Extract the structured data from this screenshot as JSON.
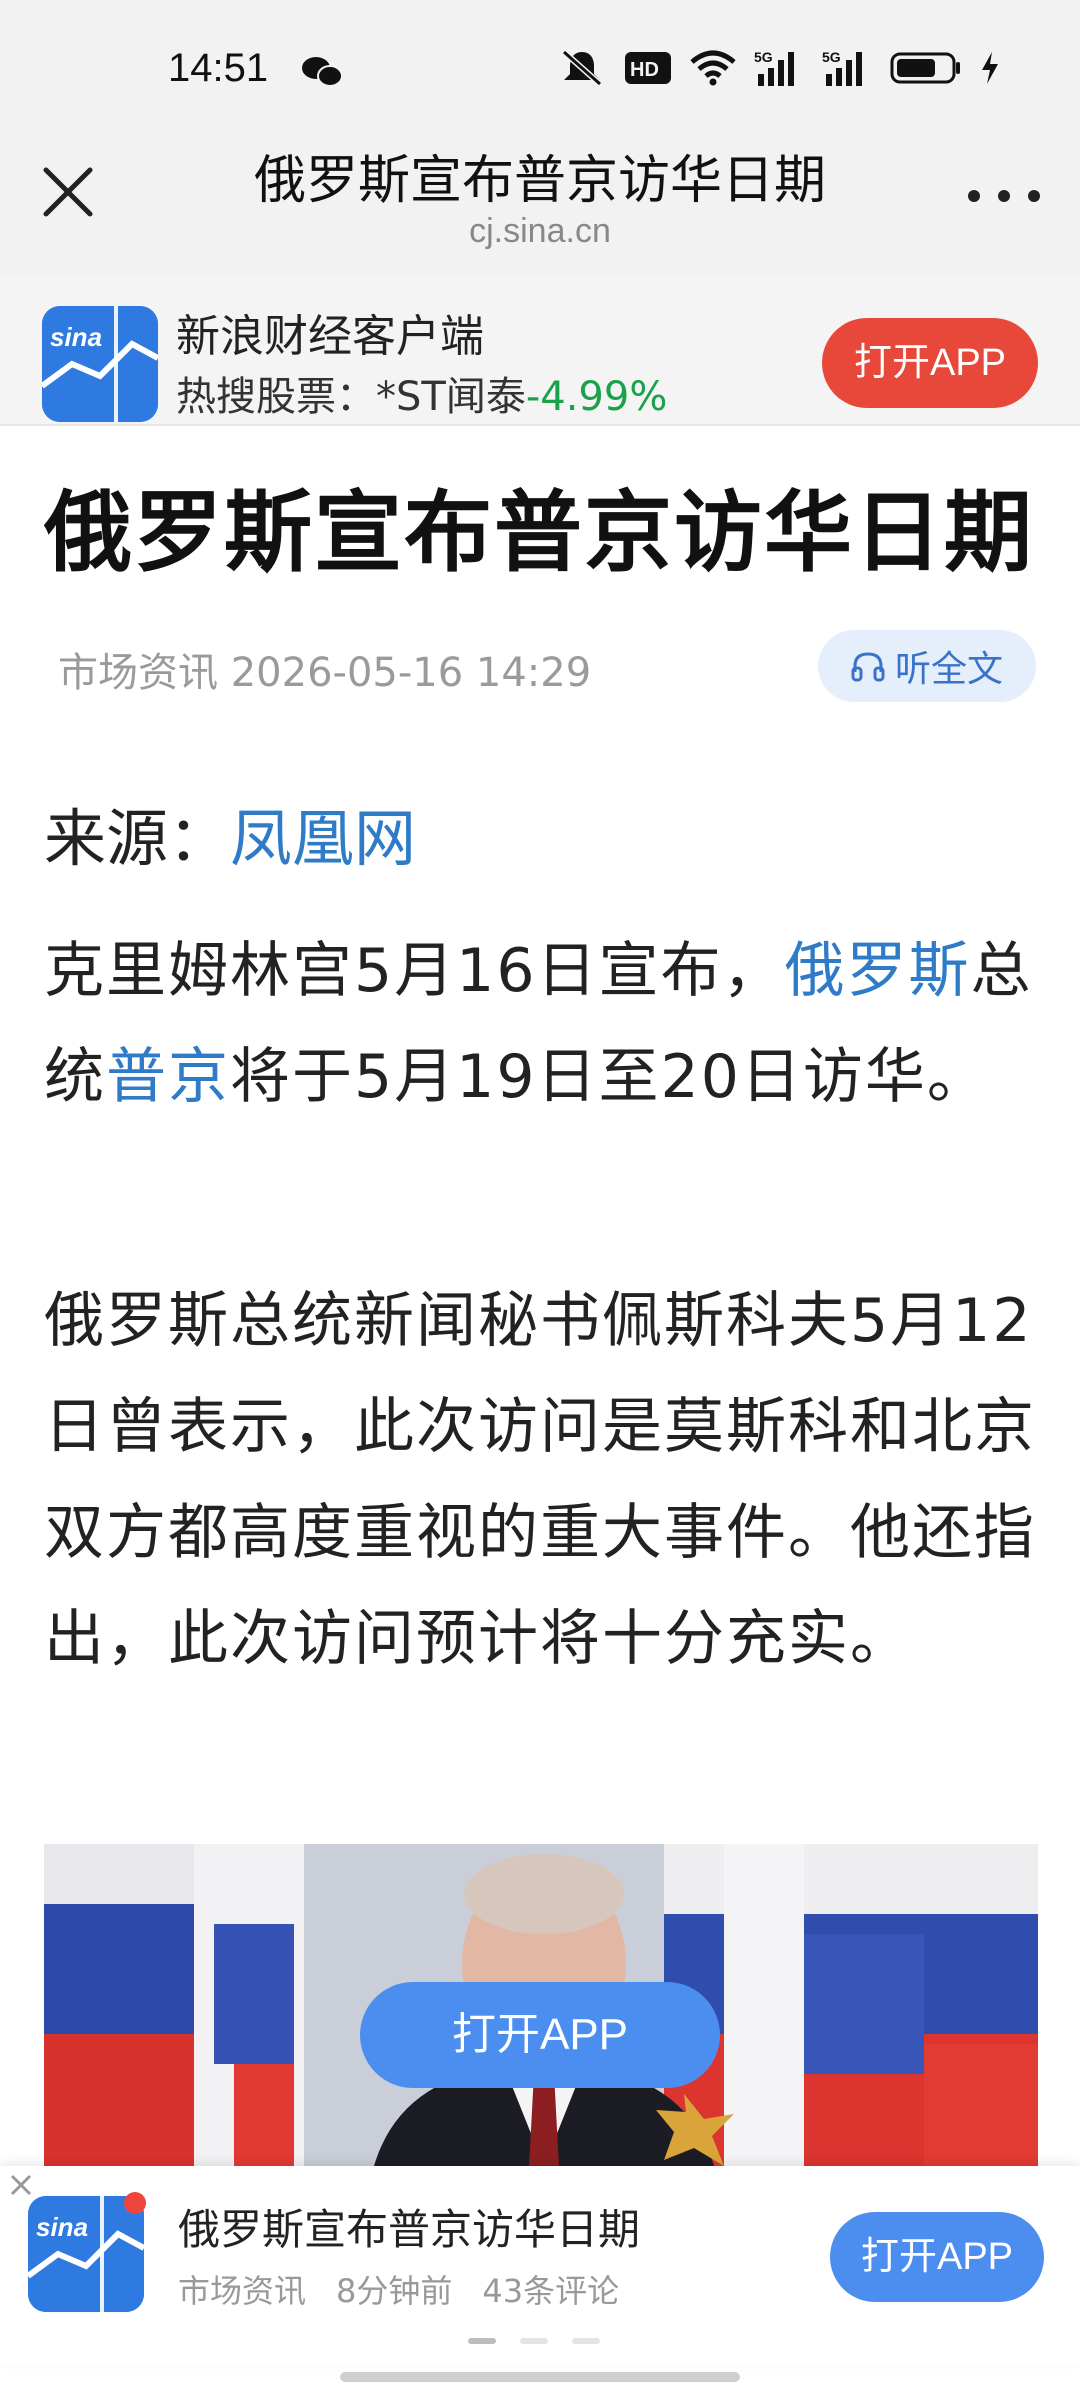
{
  "status_bar": {
    "time": "14:51",
    "icons": [
      "wechat-icon",
      "mute-icon",
      "hd-icon",
      "wifi-icon",
      "signal-5g-icon",
      "signal-5g-icon",
      "battery-icon",
      "charging-icon"
    ]
  },
  "header": {
    "title": "俄罗斯宣布普京访华日期",
    "domain": "cj.sina.cn"
  },
  "app_banner": {
    "app_name": "新浪财经客户端",
    "hot_label": "热搜股票：*ST闻泰",
    "hot_change": "-4.99%",
    "open_label": "打开APP",
    "colors": {
      "open_button": "#e8483a",
      "change": "#1aa14a"
    }
  },
  "article": {
    "title": "俄罗斯宣布普京访华日期",
    "category": "市场资讯",
    "datetime": "2026-05-16 14:29",
    "listen_label": "听全文",
    "source_label": "来源：",
    "source_name": "凤凰网",
    "p1": {
      "part1": "克里姆林宫5月16日宣布，",
      "link1": "俄罗斯",
      "part2": "总统",
      "link2": "普京",
      "part3": "将于5月19日至20日访华。"
    },
    "p2": "俄罗斯总统新闻秘书佩斯科夫5月12日曾表示，此次访问是莫斯科和北京双方都高度重视的重大事件。他还指出，此次访问预计将十分充实。",
    "image_open_label": "打开APP"
  },
  "bottom_card": {
    "title": "俄罗斯宣布普京访华日期",
    "category": "市场资讯",
    "time_ago": "8分钟前",
    "comments": "43条评论",
    "open_label": "打开APP",
    "colors": {
      "open_button": "#4b8ef0"
    }
  },
  "link_color": "#2f7bc8"
}
